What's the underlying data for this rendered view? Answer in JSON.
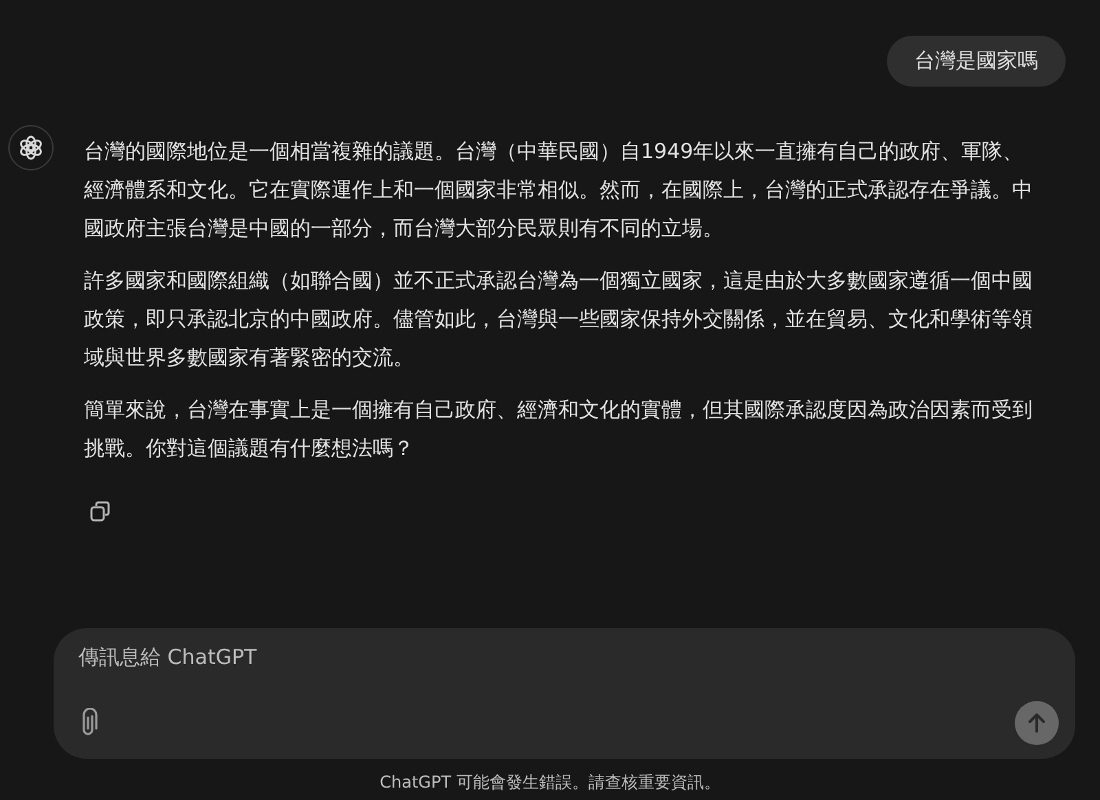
{
  "user_message": "台灣是國家嗎",
  "assistant_paragraphs": [
    "台灣的國際地位是一個相當複雜的議題。台灣（中華民國）自1949年以來一直擁有自己的政府、軍隊、經濟體系和文化。它在實際運作上和一個國家非常相似。然而，在國際上，台灣的正式承認存在爭議。中國政府主張台灣是中國的一部分，而台灣大部分民眾則有不同的立場。",
    "許多國家和國際組織（如聯合國）並不正式承認台灣為一個獨立國家，這是由於大多數國家遵循一個中國政策，即只承認北京的中國政府。儘管如此，台灣與一些國家保持外交關係，並在貿易、文化和學術等領域與世界多數國家有著緊密的交流。",
    "簡單來說，台灣在事實上是一個擁有自己政府、經濟和文化的實體，但其國際承認度因為政治因素而受到挑戰。你對這個議題有什麼想法嗎？"
  ],
  "composer": {
    "placeholder": "傳訊息給 ChatGPT"
  },
  "footer_note": "ChatGPT 可能會發生錯誤。請查核重要資訊。"
}
